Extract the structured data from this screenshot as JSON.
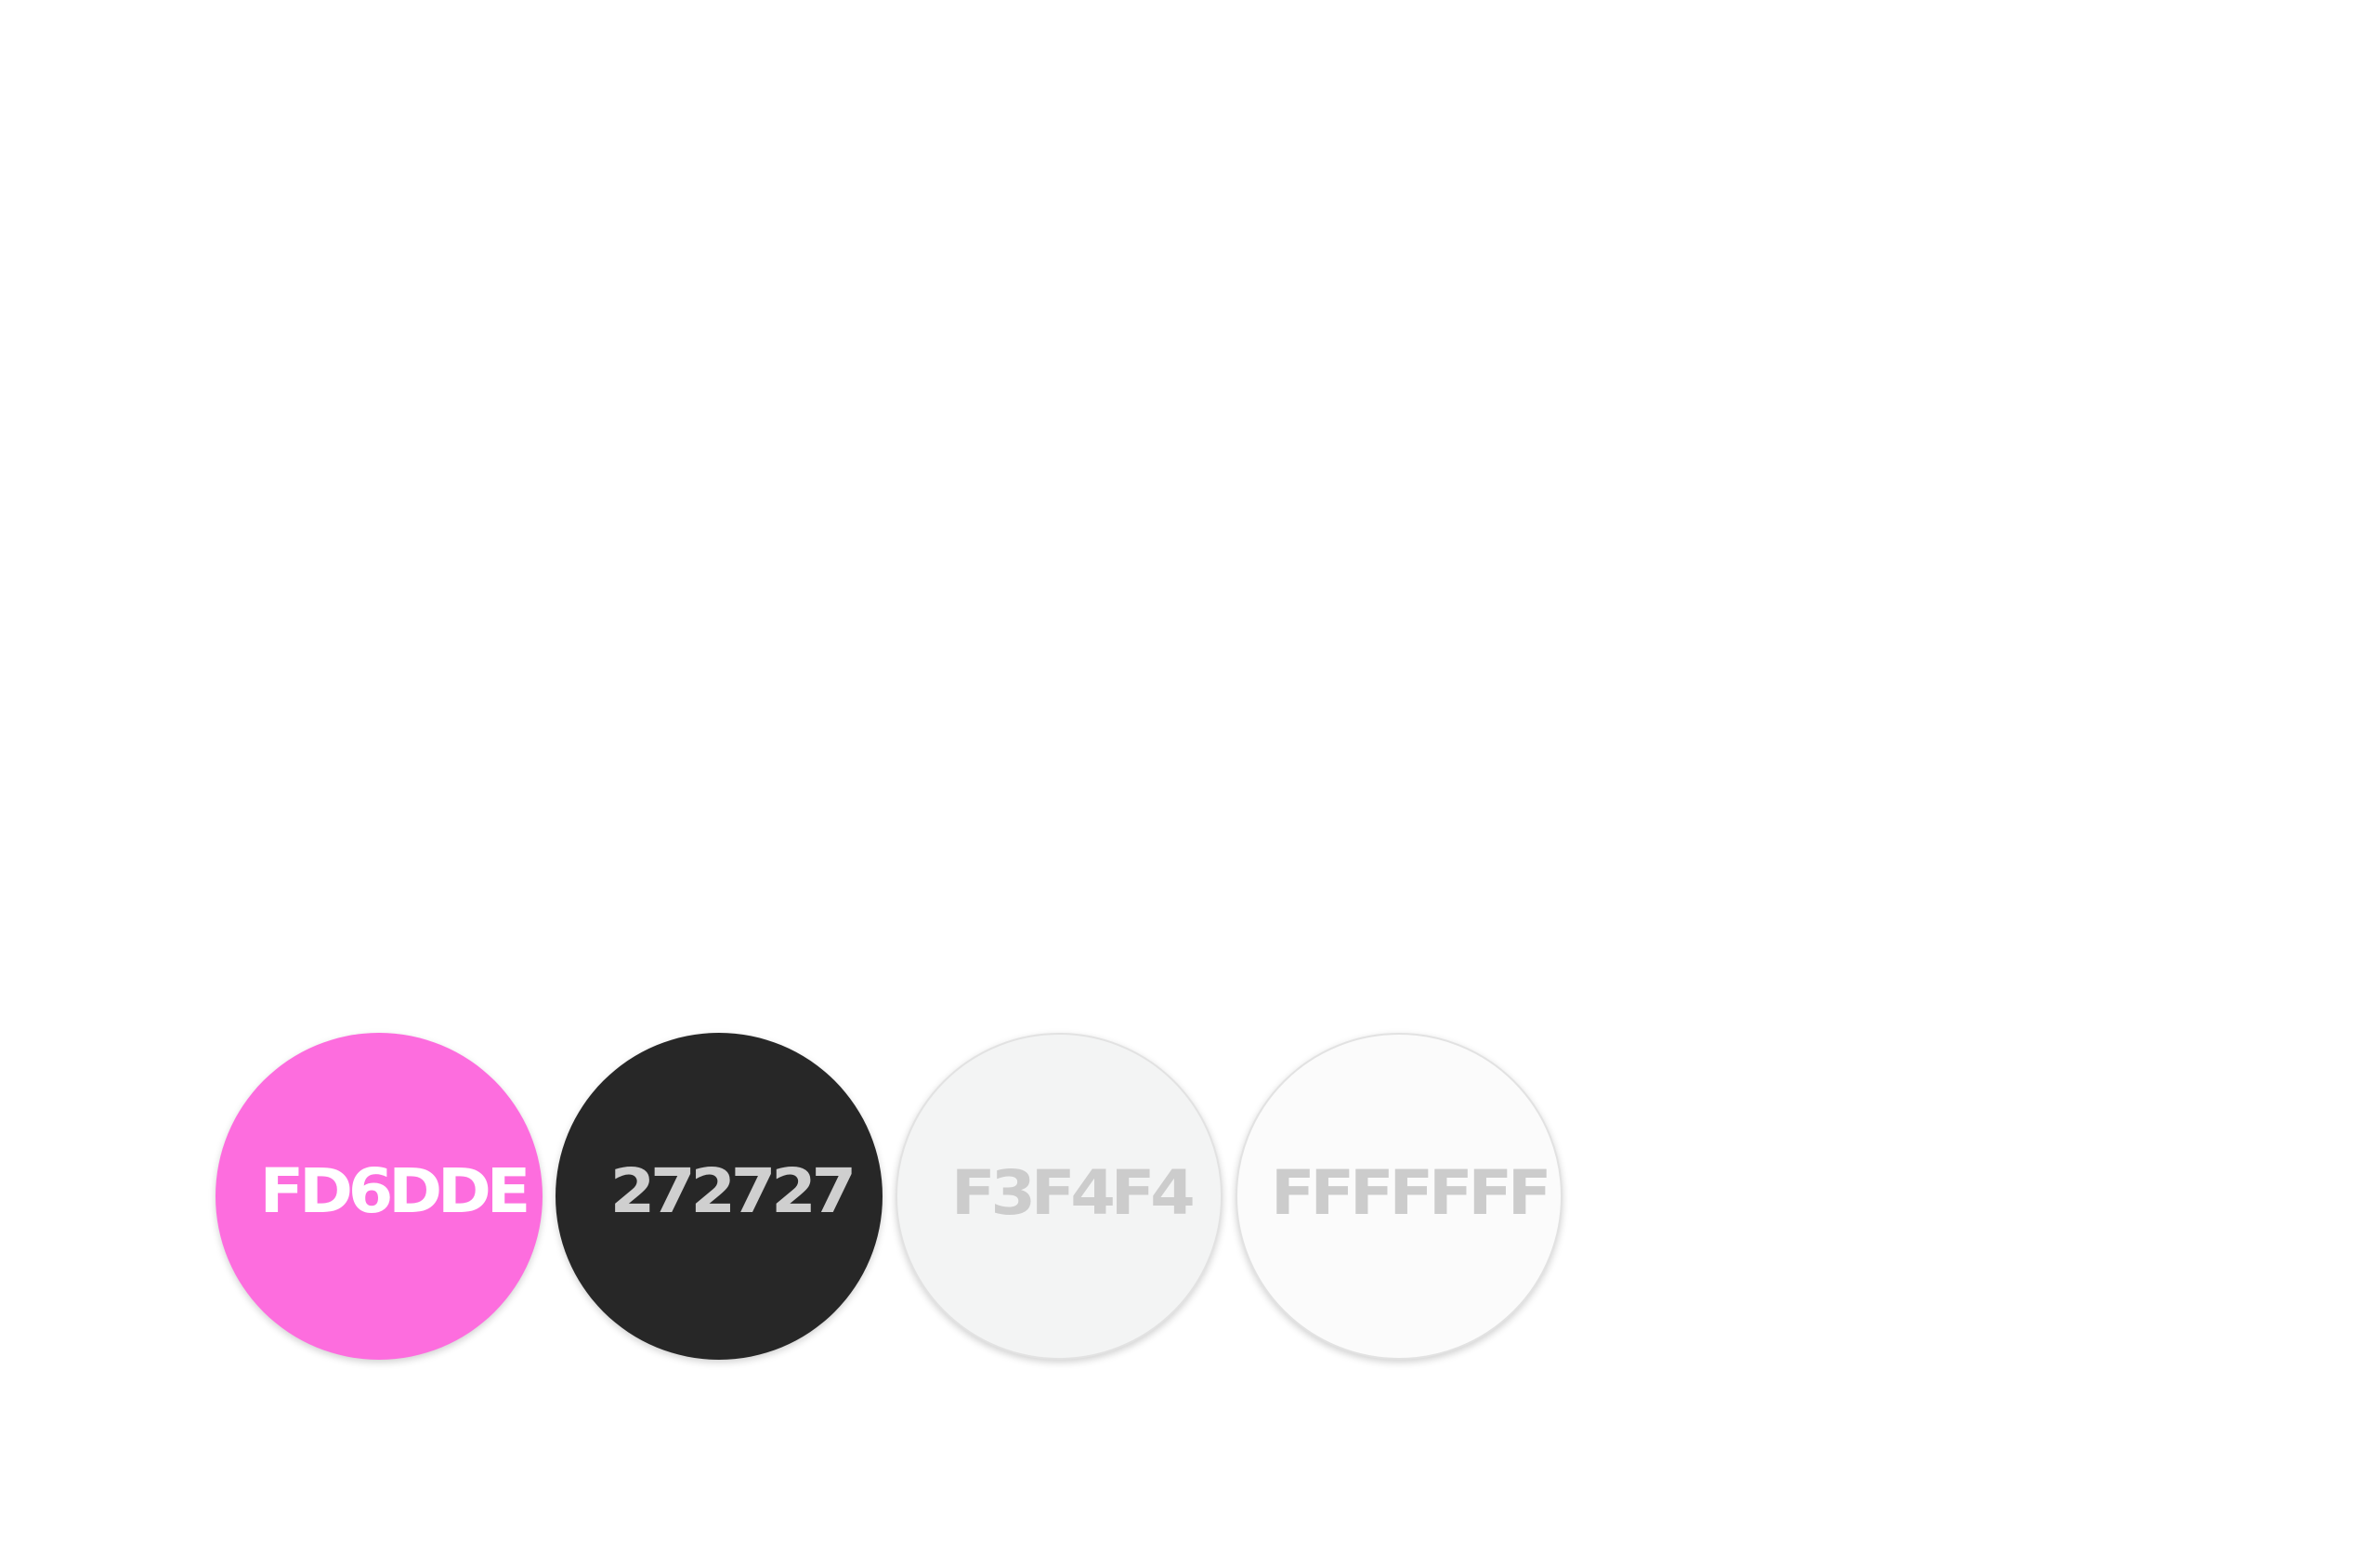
{
  "palette": {
    "swatches": [
      {
        "hex": "FD6DDE",
        "fill": "#fd6dde",
        "text_color": "#ffffff"
      },
      {
        "hex": "272727",
        "fill": "#272727",
        "text_color": "#cfcfcf"
      },
      {
        "hex": "F3F4F4",
        "fill": "#f3f4f4",
        "text_color": "#cccccc"
      },
      {
        "hex": "FFFFFFF",
        "fill": "#fbfbfb",
        "text_color": "#cccccc"
      }
    ]
  }
}
